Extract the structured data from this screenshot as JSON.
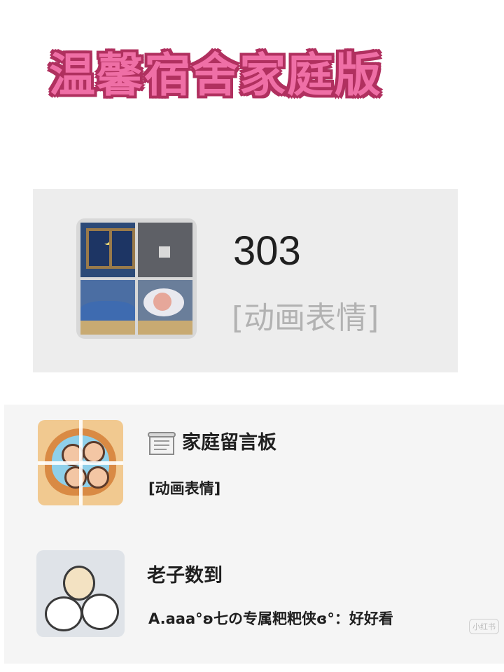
{
  "header": {
    "title": "温馨宿舍家庭版"
  },
  "chat_top": {
    "name": "303",
    "last_message": "[动画表情]"
  },
  "chat_list": {
    "items": [
      {
        "icon": "scroll-icon",
        "name": "家庭留言板",
        "last_message": "[动画表情]"
      },
      {
        "name": "老子数到",
        "last_message": "A.aaa°ʚ七の专属粑粑侠ɞ°：好好看"
      }
    ]
  },
  "watermarks": {
    "tag": "小红书"
  }
}
